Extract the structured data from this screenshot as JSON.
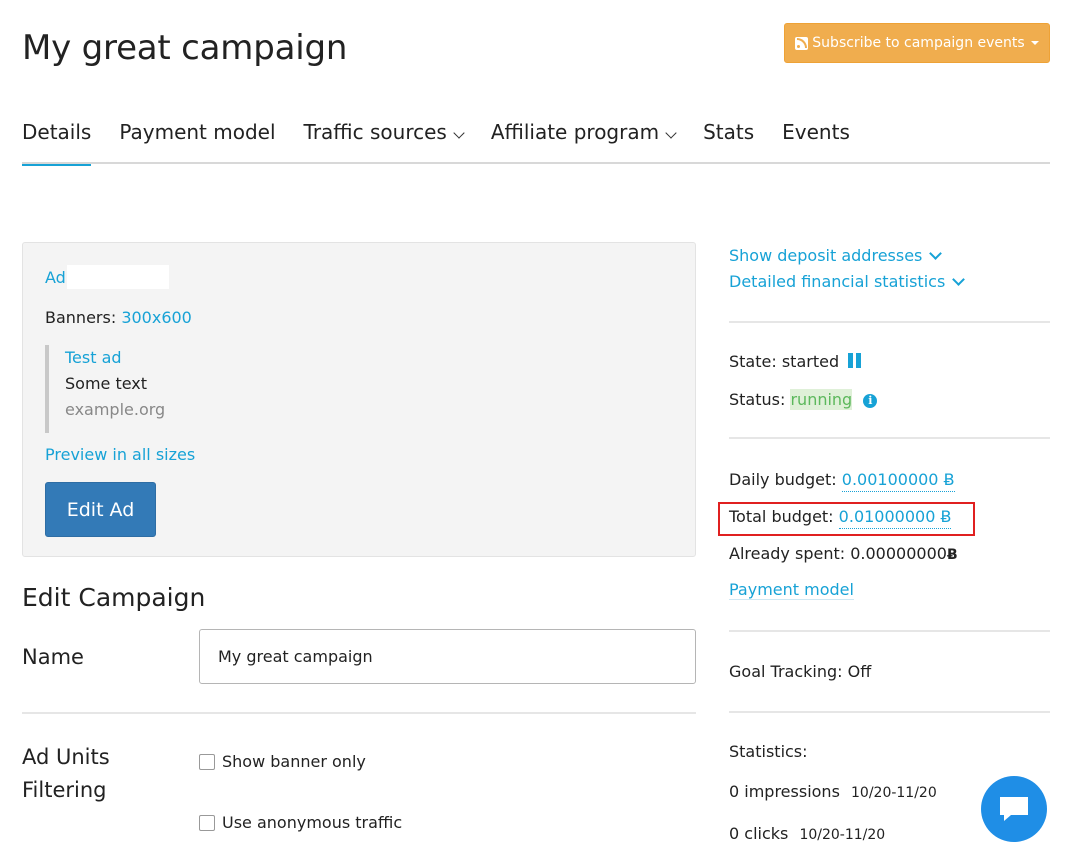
{
  "header": {
    "title": "My great campaign",
    "subscribe_label": "Subscribe to campaign events"
  },
  "tabs": [
    {
      "label": "Details",
      "active": true
    },
    {
      "label": "Payment model"
    },
    {
      "label": "Traffic sources",
      "has_dropdown": true
    },
    {
      "label": "Affiliate program",
      "has_dropdown": true
    },
    {
      "label": "Stats"
    },
    {
      "label": "Events"
    }
  ],
  "ad": {
    "label": "Ad",
    "banners_label": "Banners:",
    "banners_size": "300x600",
    "title": "Test ad",
    "text": "Some text",
    "url": "example.org",
    "preview_label": "Preview in all sizes",
    "edit_label": "Edit Ad"
  },
  "edit_campaign": {
    "title": "Edit Campaign",
    "name_label": "Name",
    "name_value": "My great campaign",
    "ad_units_label": "Ad Units Filtering",
    "show_banner_only_label": "Show banner only",
    "show_banner_only_checked": false,
    "anonymous_traffic_label": "Use anonymous traffic",
    "anonymous_traffic_checked": false
  },
  "sidebar": {
    "deposit_link": "Show deposit addresses",
    "financial_link": "Detailed financial statistics",
    "state_label": "State: started",
    "status_label": "Status:",
    "status_value": "running",
    "daily_budget_label": "Daily budget:",
    "daily_budget_value": "0.00100000 Ƀ",
    "total_budget_label": "Total budget:",
    "total_budget_value": "0.01000000 Ƀ",
    "already_spent_label": "Already spent:",
    "already_spent_value": "0.00000000",
    "payment_model_link": "Payment model",
    "goal_tracking": "Goal Tracking: Off",
    "statistics_label": "Statistics:",
    "impressions": "0 impressions",
    "impressions_range": "10/20-11/20",
    "clicks": "0 clicks",
    "clicks_range": "10/20-11/20"
  },
  "colors": {
    "accent": "#17a2d6",
    "subscribe_button": "#f0ad4e",
    "primary_button": "#337ab7",
    "status_running": "#5cb85c",
    "highlight": "#e02020",
    "chat_button": "#1f8ee6"
  },
  "icons": {
    "rss": "rss-icon",
    "pause": "pause-icon",
    "info": "info-icon",
    "bitcoin": "bitcoin-icon",
    "chat": "chat-icon"
  }
}
